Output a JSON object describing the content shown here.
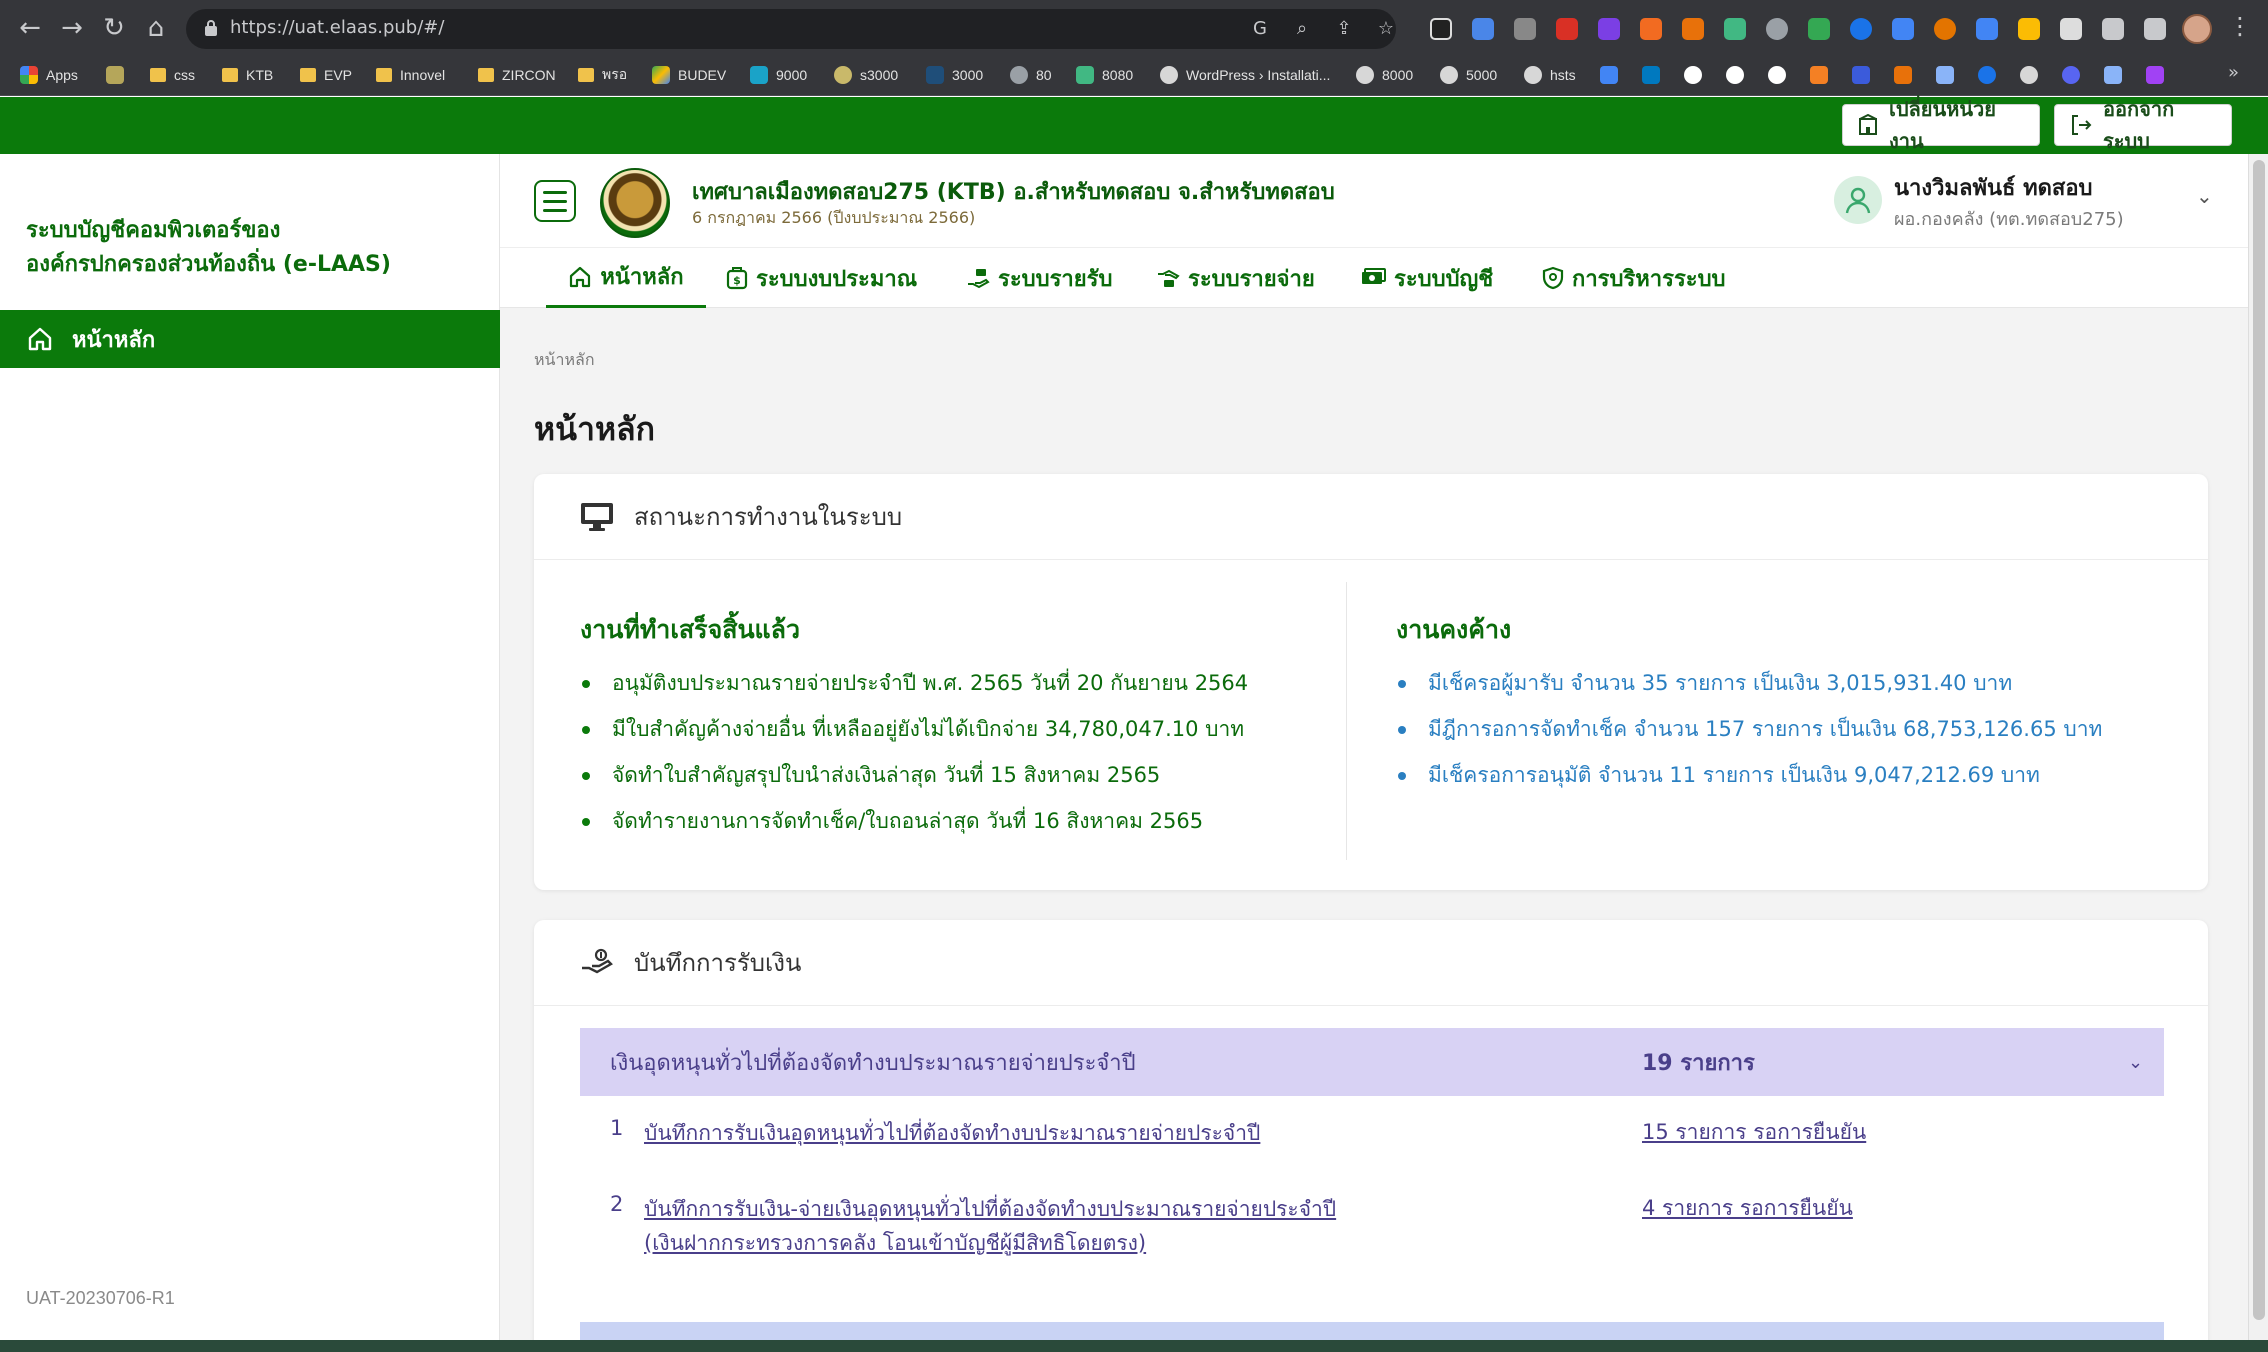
{
  "browser": {
    "url": "https://uat.elaas.pub/#/",
    "bookmarks": [
      "Apps",
      "css",
      "KTB",
      "EVP",
      "Innovel",
      "ZIRCON",
      "พรอ",
      "BUDEV",
      "9000",
      "s3000",
      "3000",
      "80",
      "8080",
      "WordPress › Installati...",
      "8000",
      "5000",
      "hsts"
    ]
  },
  "topbar": {
    "change_unit_label": "เปลี่ยนหน่วยงาน",
    "logout_label": "ออกจากระบบ"
  },
  "sidebar": {
    "title_line1": "ระบบบัญชีคอมพิวเตอร์ของ",
    "title_line2": "องค์กรปกครองส่วนท้องถิ่น (e-LAAS)",
    "home_label": "หน้าหลัก",
    "version": "UAT-20230706-R1"
  },
  "header": {
    "org_name": "เทศบาลเมืองทดสอบ275 (KTB) อ.สำหรับทดสอบ จ.สำหรับทดสอบ",
    "org_date": "6 กรกฎาคม 2566 (ปีงบประมาณ 2566)",
    "user_name": "นางวิมลพันธ์ ทดสอบ",
    "user_role": "ผอ.กองคลัง (ทต.ทดสอบ275)"
  },
  "tabs": [
    {
      "label": "หน้าหลัก",
      "icon": "home-icon"
    },
    {
      "label": "ระบบงบประมาณ",
      "icon": "budget-icon"
    },
    {
      "label": "ระบบรายรับ",
      "icon": "income-icon"
    },
    {
      "label": "ระบบรายจ่าย",
      "icon": "expense-icon"
    },
    {
      "label": "ระบบบัญชี",
      "icon": "accounting-icon"
    },
    {
      "label": "การบริหารระบบ",
      "icon": "admin-shield-icon"
    }
  ],
  "main": {
    "breadcrumb": "หน้าหลัก",
    "title": "หน้าหลัก",
    "status_card": {
      "title": "สถานะการทำงานในระบบ",
      "done_title": "งานที่ทำเสร็จสิ้นแล้ว",
      "done_items": [
        "อนุมัติงบประมาณรายจ่ายประจำปี พ.ศ. 2565 วันที่ 20 กันยายน 2564",
        "มีใบสำคัญค้างจ่ายอื่น ที่เหลืออยู่ยังไม่ได้เบิกจ่าย 34,780,047.10 บาท",
        "จัดทำใบสำคัญสรุปใบนำส่งเงินล่าสุด วันที่ 15 สิงหาคม 2565",
        "จัดทำรายงานการจัดทำเช็ค/ใบถอนล่าสุด วันที่ 16 สิงหาคม 2565"
      ],
      "pending_title": "งานคงค้าง",
      "pending_items": [
        "มีเช็ครอผู้มารับ จำนวน 35 รายการ เป็นเงิน 3,015,931.40 บาท",
        "มีฎีการอการจัดทำเช็ค จำนวน 157 รายการ เป็นเงิน 68,753,126.65 บาท",
        "มีเช็ครอการอนุมัติ จำนวน 11 รายการ เป็นเงิน 9,047,212.69 บาท"
      ]
    },
    "receipt_card": {
      "title": "บันทึกการรับเงิน",
      "group_name": "เงินอุดหนุนทั่วไปที่ต้องจัดทำงบประมาณรายจ่ายประจำปี",
      "group_count": "19 รายการ",
      "rows": [
        {
          "num": "1",
          "line1": "บันทึกการรับเงินอุดหนุนทั่วไปที่ต้องจัดทำงบประมาณรายจ่ายประจำปี",
          "line2": "",
          "count": "15 รายการ รอการยืนยัน"
        },
        {
          "num": "2",
          "line1": "บันทึกการรับเงิน-จ่ายเงินอุดหนุนทั่วไปที่ต้องจัดทำงบประมาณรายจ่ายประจำปี",
          "line2": "(เงินฝากกระทรวงการคลัง โอนเข้าบัญชีผู้มีสิทธิโดยตรง)",
          "count": "4 รายการ รอการยืนยัน"
        }
      ]
    }
  },
  "colors": {
    "brand_green": "#0b7a0b",
    "pending_blue": "#2a7fc1",
    "group_lavender": "#d8d2f4"
  }
}
